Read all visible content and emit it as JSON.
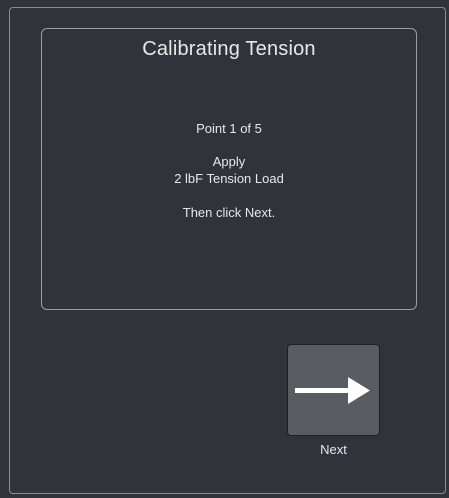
{
  "panel": {
    "title": "Calibrating Tension",
    "point_text": "Point 1 of 5",
    "apply_text": "Apply",
    "load_text": "2 lbF Tension Load",
    "instruction_text": "Then click Next."
  },
  "next_button": {
    "label": "Next",
    "icon": "arrow-right-icon"
  },
  "colors": {
    "background": "#303339",
    "button": "#595c61",
    "text": "#e6e8ea"
  }
}
